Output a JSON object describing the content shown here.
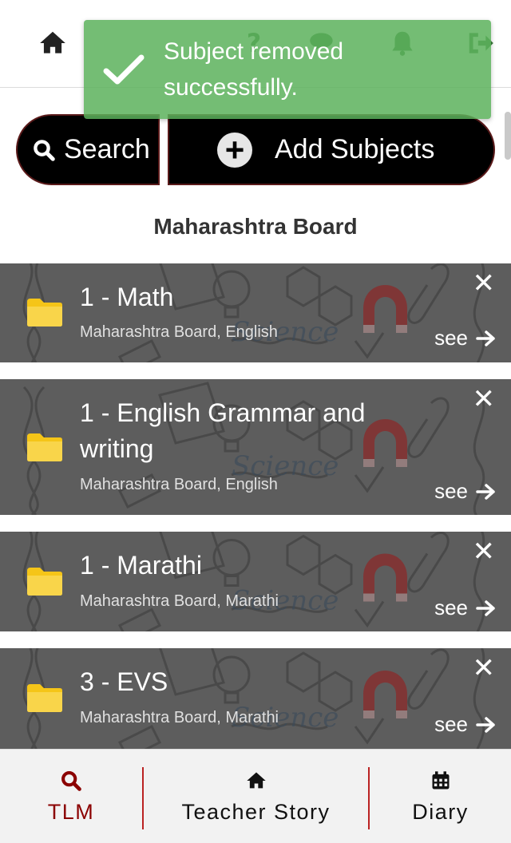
{
  "toast": {
    "message": "Subject removed successfully."
  },
  "header": {
    "icons": [
      "home-icon",
      "help-icon",
      "chat-icon",
      "bell-icon",
      "logout-icon"
    ]
  },
  "actions": {
    "search_label": "Search",
    "add_label": "Add Subjects"
  },
  "board_title": "Maharashtra Board",
  "subjects": [
    {
      "title": "1 - Math",
      "subtitle": "Maharashtra Board, English",
      "see": "see"
    },
    {
      "title": "1 - English Grammar and writing",
      "subtitle": "Maharashtra Board, English",
      "see": "see"
    },
    {
      "title": "1 - Marathi",
      "subtitle": "Maharashtra Board, Marathi",
      "see": "see"
    },
    {
      "title": "3 - EVS",
      "subtitle": "Maharashtra Board, Marathi",
      "see": "see"
    }
  ],
  "bottom_nav": {
    "tlm": "TLM",
    "teacher_story": "Teacher Story",
    "diary": "Diary"
  },
  "colors": {
    "toast_green": "#5cb25c",
    "accent_red": "#8b0000",
    "folder_yellow": "#f5c518"
  }
}
